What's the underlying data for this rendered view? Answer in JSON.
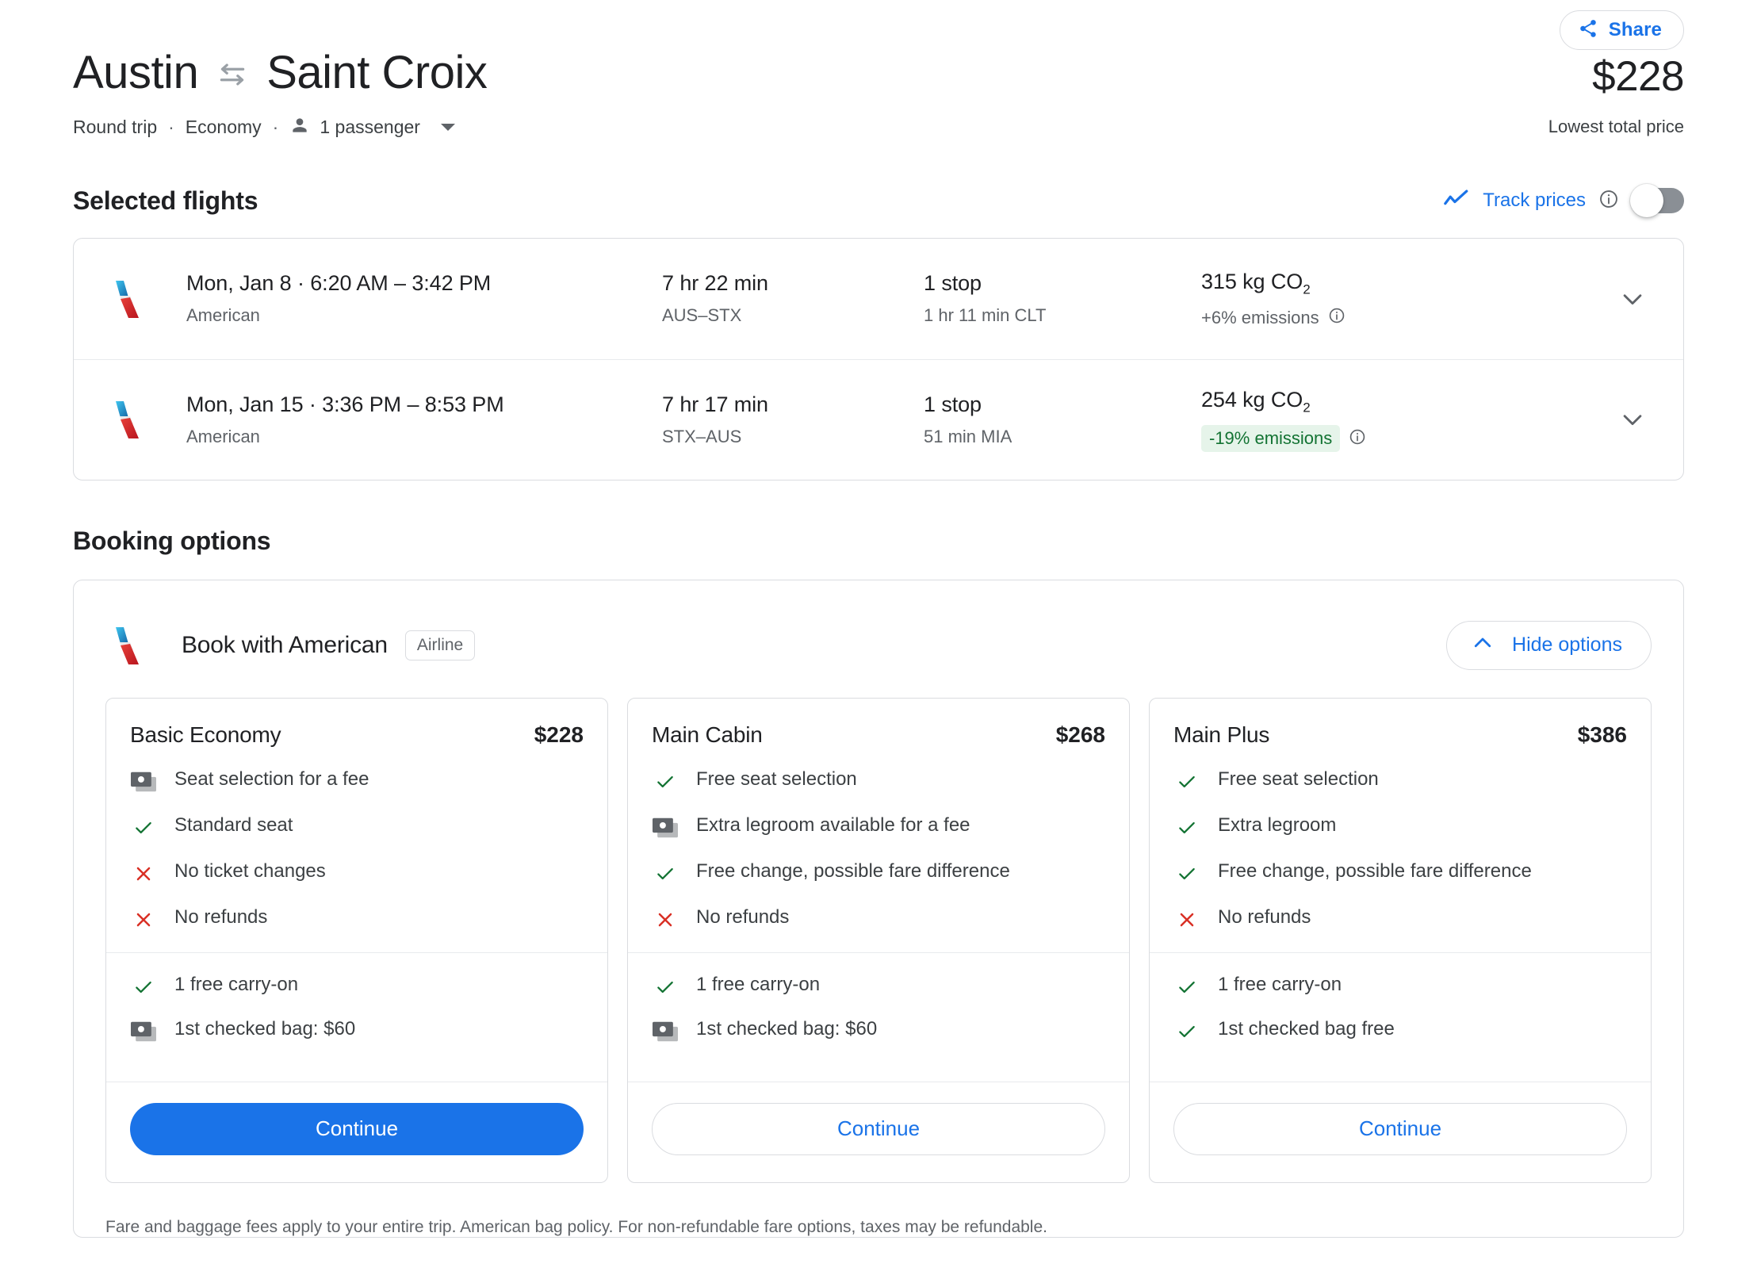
{
  "header": {
    "share_label": "Share",
    "share_icon": "share-icon",
    "origin": "Austin",
    "destination": "Saint Croix",
    "swap_icon": "swap-arrows-icon",
    "total_price": "$228",
    "price_caption": "Lowest total price",
    "trip_type": "Round trip",
    "cabin_class": "Economy",
    "separator": "·",
    "passenger_icon": "person-icon",
    "passengers": "1 passenger"
  },
  "selected_flights": {
    "section_title": "Selected flights",
    "track_prices_label": "Track prices",
    "track_prices_icon": "trending-line-icon",
    "track_prices_info_icon": "info-icon",
    "track_prices_enabled": false,
    "rows": [
      {
        "airline_logo": "american-airlines-logo",
        "when": "Mon, Jan 8  ·  6:20 AM – 3:42 PM",
        "airline": "American",
        "duration": "7 hr 22 min",
        "route": "AUS–STX",
        "stops": "1 stop",
        "layover": "1 hr 11 min CLT",
        "co2_value": "315",
        "co2_unit": "kg CO",
        "co2_sub": "2",
        "emissions": "+6% emissions",
        "emissions_highlight": false,
        "info_icon": "info-icon",
        "expand_icon": "chevron-down-icon"
      },
      {
        "airline_logo": "american-airlines-logo",
        "when": "Mon, Jan 15  ·  3:36 PM – 8:53 PM",
        "airline": "American",
        "duration": "7 hr 17 min",
        "route": "STX–AUS",
        "stops": "1 stop",
        "layover": "51 min MIA",
        "co2_value": "254",
        "co2_unit": "kg CO",
        "co2_sub": "2",
        "emissions": "-19% emissions",
        "emissions_highlight": true,
        "info_icon": "info-icon",
        "expand_icon": "chevron-down-icon"
      }
    ]
  },
  "booking_options": {
    "section_title": "Booking options",
    "provider_logo": "american-airlines-logo",
    "provider_title": "Book with American",
    "provider_chip": "Airline",
    "hide_options_label": "Hide options",
    "hide_options_icon": "chevron-up-icon",
    "continue_label": "Continue",
    "footnote": "Fare and baggage fees apply to your entire trip. American bag policy. For non-refundable fare options, taxes may be refundable.",
    "fares": [
      {
        "name": "Basic Economy",
        "price": "$228",
        "primary_cta": true,
        "features": [
          {
            "icon": "fee-money-icon",
            "text": "Seat selection for a fee"
          },
          {
            "icon": "check-icon",
            "text": "Standard seat"
          },
          {
            "icon": "cross-icon",
            "text": "No ticket changes"
          },
          {
            "icon": "cross-icon",
            "text": "No refunds"
          }
        ],
        "baggage": [
          {
            "icon": "check-icon",
            "text": "1 free carry-on"
          },
          {
            "icon": "fee-money-icon",
            "text": "1st checked bag: $60"
          }
        ]
      },
      {
        "name": "Main Cabin",
        "price": "$268",
        "primary_cta": false,
        "features": [
          {
            "icon": "check-icon",
            "text": "Free seat selection"
          },
          {
            "icon": "fee-money-icon",
            "text": "Extra legroom available for a fee"
          },
          {
            "icon": "check-icon",
            "text": "Free change, possible fare difference"
          },
          {
            "icon": "cross-icon",
            "text": "No refunds"
          }
        ],
        "baggage": [
          {
            "icon": "check-icon",
            "text": "1 free carry-on"
          },
          {
            "icon": "fee-money-icon",
            "text": "1st checked bag: $60"
          }
        ]
      },
      {
        "name": "Main Plus",
        "price": "$386",
        "primary_cta": false,
        "features": [
          {
            "icon": "check-icon",
            "text": "Free seat selection"
          },
          {
            "icon": "check-icon",
            "text": "Extra legroom"
          },
          {
            "icon": "check-icon",
            "text": "Free change, possible fare difference"
          },
          {
            "icon": "cross-icon",
            "text": "No refunds"
          }
        ],
        "baggage": [
          {
            "icon": "check-icon",
            "text": "1 free carry-on"
          },
          {
            "icon": "check-icon",
            "text": "1st checked bag free"
          }
        ]
      }
    ]
  },
  "colors": {
    "accent_blue": "#1a73e8",
    "green": "#137333",
    "green_bg": "#e6f4ea",
    "red": "#d93025",
    "text_primary": "#202124",
    "text_secondary": "#5f6368",
    "border": "#dadce0"
  }
}
